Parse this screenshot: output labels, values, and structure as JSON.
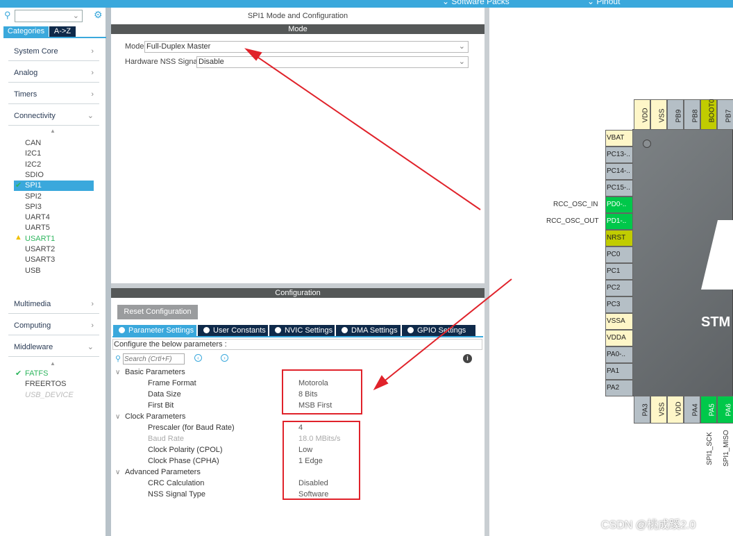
{
  "topbar": {
    "software_packs": "Software Packs",
    "pinout": "Pinout"
  },
  "sidebar": {
    "tabs": {
      "categories": "Categories",
      "az": "A->Z"
    },
    "categories": [
      {
        "label": "System Core"
      },
      {
        "label": "Analog"
      },
      {
        "label": "Timers"
      },
      {
        "label": "Connectivity"
      },
      {
        "label": "Multimedia"
      },
      {
        "label": "Computing"
      },
      {
        "label": "Middleware"
      }
    ],
    "connectivity_items": [
      "CAN",
      "I2C1",
      "I2C2",
      "SDIO",
      "SPI1",
      "SPI2",
      "SPI3",
      "UART4",
      "UART5",
      "USART1",
      "USART2",
      "USART3",
      "USB"
    ],
    "selected": "SPI1",
    "warning_item": "USART1",
    "middleware_items": [
      "FATFS",
      "FREERTOS",
      "USB_DEVICE"
    ]
  },
  "panel": {
    "title": "SPI1 Mode and Configuration",
    "mode_header": "Mode",
    "mode_label": "Mode",
    "mode_value": "Full-Duplex Master",
    "nss_label": "Hardware NSS Signal",
    "nss_value": "Disable",
    "config_header": "Configuration",
    "reset_button": "Reset Configuration",
    "tabs": [
      "Parameter Settings",
      "User Constants",
      "NVIC Settings",
      "DMA Settings",
      "GPIO Settings"
    ],
    "configure_text": "Configure the below parameters :",
    "search_placeholder": "Search (Crtl+F)",
    "groups": [
      {
        "name": "Basic Parameters",
        "params": [
          {
            "label": "Frame Format",
            "value": "Motorola"
          },
          {
            "label": "Data Size",
            "value": "8 Bits"
          },
          {
            "label": "First Bit",
            "value": "MSB First"
          }
        ]
      },
      {
        "name": "Clock Parameters",
        "params": [
          {
            "label": "Prescaler (for Baud Rate)",
            "value": "4"
          },
          {
            "label": "Baud Rate",
            "value": "18.0 MBits/s"
          },
          {
            "label": "Clock Polarity (CPOL)",
            "value": "Low"
          },
          {
            "label": "Clock Phase (CPHA)",
            "value": "1 Edge"
          }
        ]
      },
      {
        "name": "Advanced Parameters",
        "params": [
          {
            "label": "CRC Calculation",
            "value": "Disabled"
          },
          {
            "label": "NSS Signal Type",
            "value": "Software"
          }
        ]
      }
    ]
  },
  "pinout": {
    "left_pins": [
      "VBAT",
      "PC13-..",
      "PC14-..",
      "PC15-..",
      "PD0-..",
      "PD1-..",
      "NRST",
      "PC0",
      "PC1",
      "PC2",
      "PC3",
      "VSSA",
      "VDDA",
      "PA0-..",
      "PA1",
      "PA2"
    ],
    "top_pins": [
      "VDD",
      "VSS",
      "PB9",
      "PB8",
      "BOOT0",
      "PB7"
    ],
    "bottom_pins": [
      "PA3",
      "VSS",
      "VDD",
      "PA4",
      "PA5",
      "PA6"
    ],
    "signal_labels": {
      "pd0": "RCC_OSC_IN",
      "pd1": "RCC_OSC_OUT",
      "pa5": "SPI1_SCK",
      "pa6": "SPI1_MISO"
    },
    "chip_text": "STM"
  },
  "watermark": "CSDN @桃成蹊2.0",
  "colors": {
    "accent": "#3aa8dc",
    "navy": "#0f2a4a",
    "pin_green": "#00c84a",
    "pin_yellow": "#fef6c8",
    "pin_olive": "#c1cc00",
    "annotation_red": "#e0222a"
  }
}
